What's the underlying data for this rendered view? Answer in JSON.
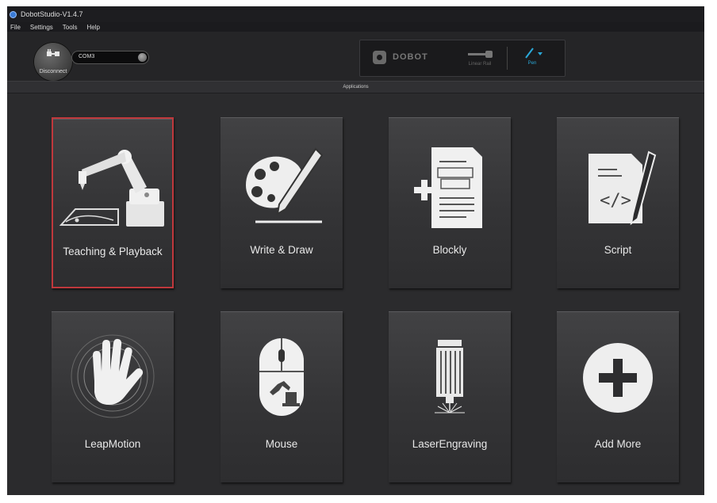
{
  "window": {
    "title": "DobotStudio-V1.4.7"
  },
  "menu": [
    "File",
    "Settings",
    "Tools",
    "Help"
  ],
  "toolbar": {
    "disconnect_label": "Disconnect",
    "port_value": "COM3",
    "brand": "DOBOT",
    "linear_rail_label": "Linear Rail",
    "end_tool_label": "Pen"
  },
  "section_title": "Applications",
  "apps": [
    {
      "label": "Teaching & Playback",
      "icon": "robot-arm-icon",
      "selected": true
    },
    {
      "label": "Write & Draw",
      "icon": "palette-pen-icon",
      "selected": false
    },
    {
      "label": "Blockly",
      "icon": "blockly-document-icon",
      "selected": false
    },
    {
      "label": "Script",
      "icon": "script-document-icon",
      "selected": false
    },
    {
      "label": "LeapMotion",
      "icon": "hand-icon",
      "selected": false
    },
    {
      "label": "Mouse",
      "icon": "mouse-icon",
      "selected": false
    },
    {
      "label": "LaserEngraving",
      "icon": "laser-icon",
      "selected": false
    },
    {
      "label": "Add More",
      "icon": "plus-circle-icon",
      "selected": false
    }
  ],
  "colors": {
    "selected_border": "#c0383c",
    "accent": "#2aa8d8",
    "background": "#2b2b2d"
  }
}
